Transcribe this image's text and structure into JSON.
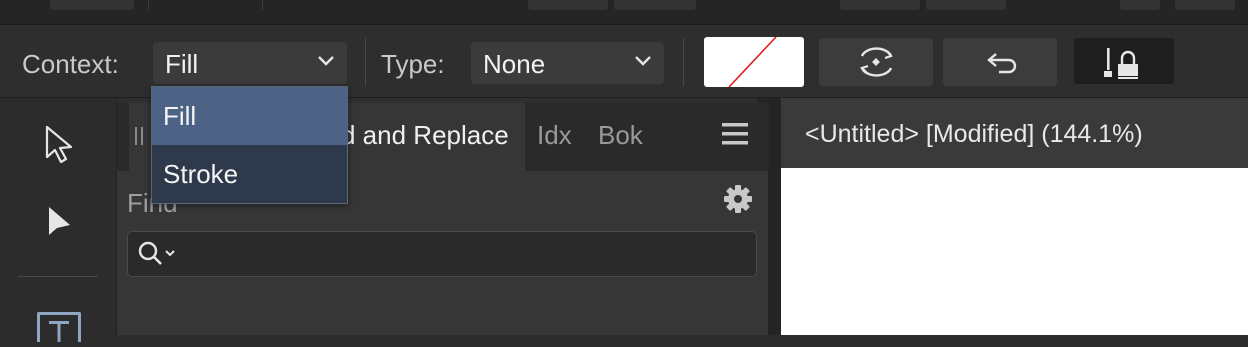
{
  "context_toolbar": {
    "context_label": "Context:",
    "context_value": "Fill",
    "type_label": "Type:",
    "type_value": "None",
    "fill_swatch_color": "#ffffff",
    "swatch_slash_color": "#e02020"
  },
  "context_dropdown": {
    "options": [
      "Fill",
      "Stroke"
    ],
    "selected_index": 0
  },
  "panel": {
    "tabs": [
      {
        "label": "d and Replace",
        "active": true
      },
      {
        "label": "Idx",
        "active": false
      },
      {
        "label": "Bok",
        "active": false
      }
    ],
    "find_label": "Find",
    "search_value": ""
  },
  "document": {
    "title": "<Untitled> [Modified] (144.1%)"
  },
  "colors": {
    "popup_selected": "#4d6386",
    "popup_bg": "#2e3a4b",
    "app_bg": "#2b2b2b"
  }
}
